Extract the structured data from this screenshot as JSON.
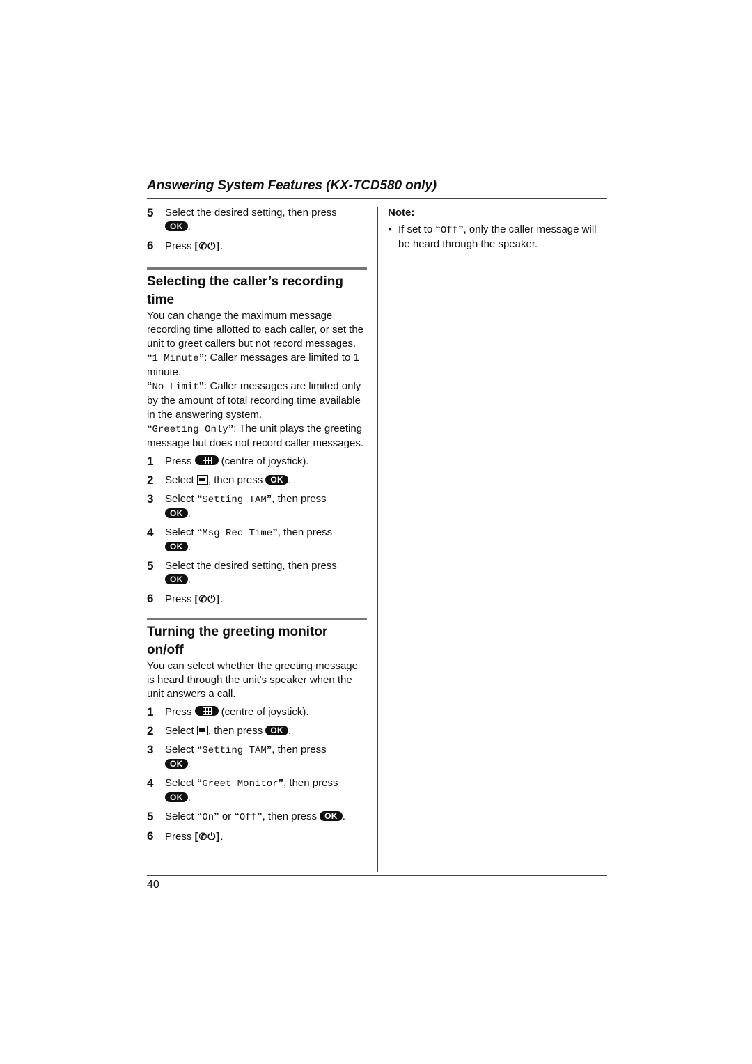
{
  "header": {
    "title": "Answering System Features (KX-TCD580 only)"
  },
  "footer": {
    "page_number": "40"
  },
  "icons": {
    "ok": "OK",
    "off_key": "[ ⏻ ]"
  },
  "top_steps": [
    {
      "num": "5",
      "text": "Select the desired setting, then press "
    },
    {
      "num": "6",
      "text": "Press "
    }
  ],
  "section1": {
    "title": "Selecting the caller’s recording time",
    "intro": "You can change the maximum message recording time allotted to each caller, or set the unit to greet callers but not record messages.",
    "options": [
      {
        "name": "1 Minute",
        "desc": ": Caller messages are limited to 1 minute."
      },
      {
        "name": "No Limit",
        "desc": ": Caller messages are limited only by the amount of total recording time available in the answering system."
      },
      {
        "name": "Greeting Only",
        "desc": ": The unit plays the greeting message but does not record caller messages."
      }
    ],
    "steps": [
      {
        "num": "1",
        "pre": "Press ",
        "post": " (centre of joystick)."
      },
      {
        "num": "2",
        "pre": "Select ",
        "mid": ", then press ",
        "post": "."
      },
      {
        "num": "3",
        "pre": "Select ",
        "item": "Setting TAM",
        "post": ", then press "
      },
      {
        "num": "4",
        "pre": "Select ",
        "item": "Msg Rec Time",
        "post": ", then press "
      },
      {
        "num": "5",
        "pre": "Select the desired setting, then press "
      },
      {
        "num": "6",
        "pre": "Press "
      }
    ]
  },
  "section2": {
    "title": "Turning the greeting monitor on/off",
    "intro": "You can select whether the greeting message is heard through the unit's speaker when the unit answers a call.",
    "steps": [
      {
        "num": "1",
        "pre": "Press ",
        "post": " (centre of joystick)."
      },
      {
        "num": "2",
        "pre": "Select ",
        "mid": ", then press ",
        "post": "."
      },
      {
        "num": "3",
        "pre": "Select ",
        "item": "Setting TAM",
        "post": ", then press "
      },
      {
        "num": "4",
        "pre": "Select ",
        "item": "Greet Monitor",
        "post": ", then press "
      },
      {
        "num": "5",
        "pre": "Select ",
        "item": "On",
        "mid": " or ",
        "item2": "Off",
        "post": ", then press "
      },
      {
        "num": "6",
        "pre": "Press "
      }
    ]
  },
  "note": {
    "title": "Note:",
    "bullets": [
      {
        "pre": "If set to ",
        "item": "Off",
        "post": ", only the caller message will be heard through the speaker."
      }
    ]
  }
}
